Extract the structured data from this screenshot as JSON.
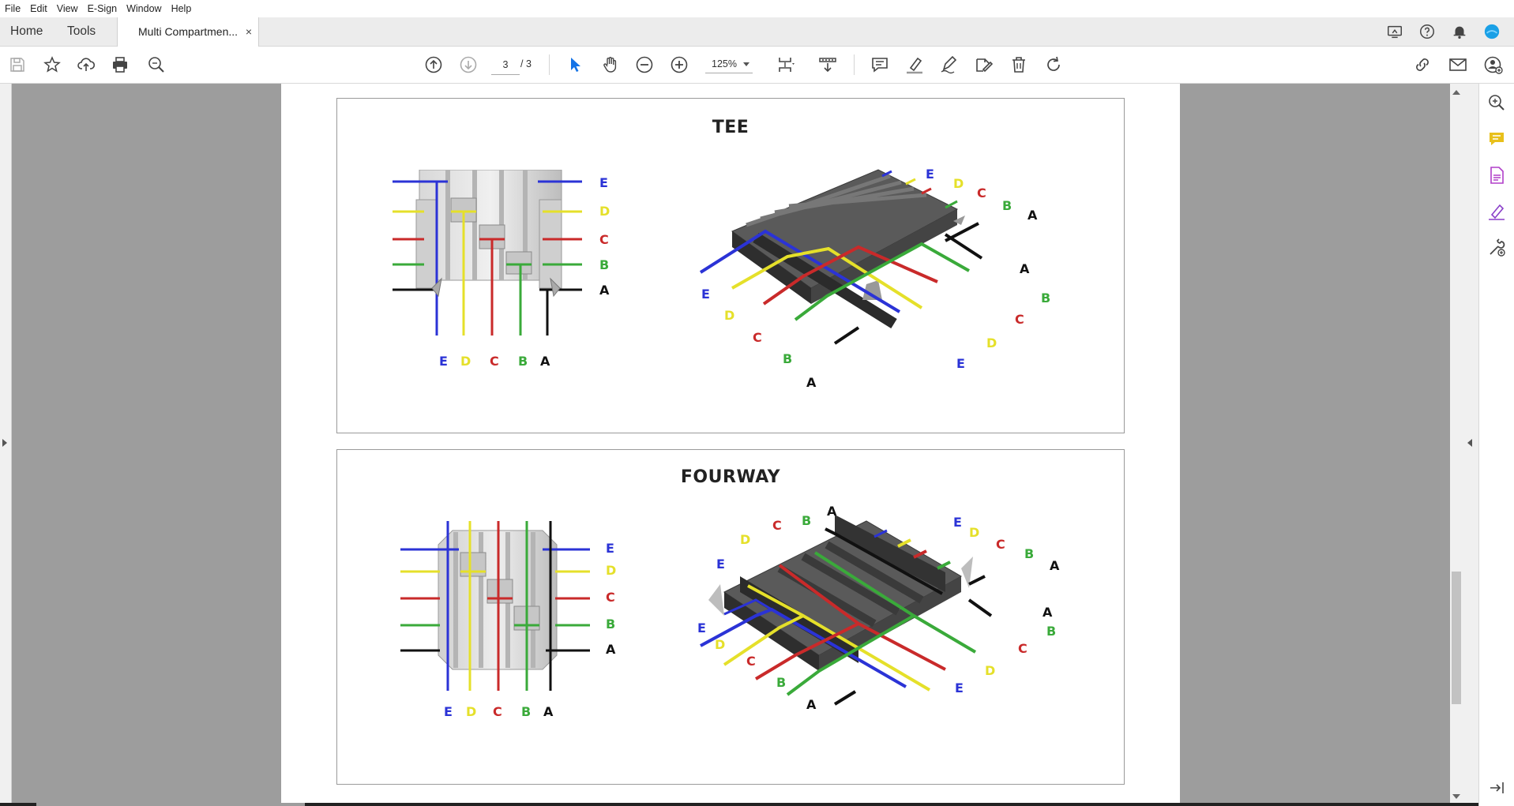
{
  "menu": [
    "File",
    "Edit",
    "View",
    "E-Sign",
    "Window",
    "Help"
  ],
  "nav": {
    "home": "Home",
    "tools": "Tools"
  },
  "document_tab": {
    "title": "Multi Compartmen...",
    "close": "×"
  },
  "toolbar": {
    "current_page": "3",
    "total_pages": "/ 3",
    "zoom": "125%"
  },
  "icons": {
    "top_right": [
      "share-screen-icon",
      "help-icon",
      "bell-icon",
      "profile-icon"
    ],
    "left_tools": [
      "save-icon",
      "star-icon",
      "upload-icon",
      "print-icon",
      "find-icon"
    ],
    "center_tools": [
      "page-up-icon",
      "page-down-icon",
      "select-cursor-icon",
      "hand-icon",
      "zoom-out-icon",
      "zoom-in-icon",
      "fit-page-icon",
      "scroll-mode-icon",
      "comment-icon",
      "highlight-icon",
      "draw-icon",
      "fill-sign-icon",
      "delete-icon",
      "rotate-icon"
    ],
    "right_tools": [
      "link-icon",
      "mail-icon",
      "account-icon"
    ],
    "right_panel": [
      "zoom-panel-icon",
      "comment-panel-icon",
      "export-pdf-icon",
      "fill-sign-panel-icon",
      "more-tools-icon",
      "expand-panel-icon"
    ]
  },
  "colors": {
    "accent": "#1473e6",
    "E": "#2b33d6",
    "D": "#e5e02a",
    "C": "#c92a2a",
    "B": "#3aaa3a",
    "A": "#111111"
  },
  "panels": [
    {
      "title": "TEE",
      "plan_right_labels": [
        "E",
        "D",
        "C",
        "B",
        "A"
      ],
      "plan_bottom_labels": [
        "E",
        "D",
        "C",
        "B",
        "A"
      ],
      "iso_labels": [
        "E",
        "D",
        "C",
        "B",
        "A",
        "A",
        "B",
        "C",
        "D",
        "E",
        "E",
        "D",
        "C",
        "B",
        "A"
      ]
    },
    {
      "title": "FOURWAY",
      "plan_right_labels": [
        "E",
        "D",
        "C",
        "B",
        "A"
      ],
      "plan_bottom_labels": [
        "E",
        "D",
        "C",
        "B",
        "A"
      ],
      "iso_labels": [
        "A",
        "C",
        "B",
        "D",
        "E",
        "E",
        "D",
        "C",
        "B",
        "A",
        "A",
        "B",
        "C",
        "D",
        "E",
        "E",
        "D",
        "C",
        "B",
        "A"
      ]
    }
  ]
}
